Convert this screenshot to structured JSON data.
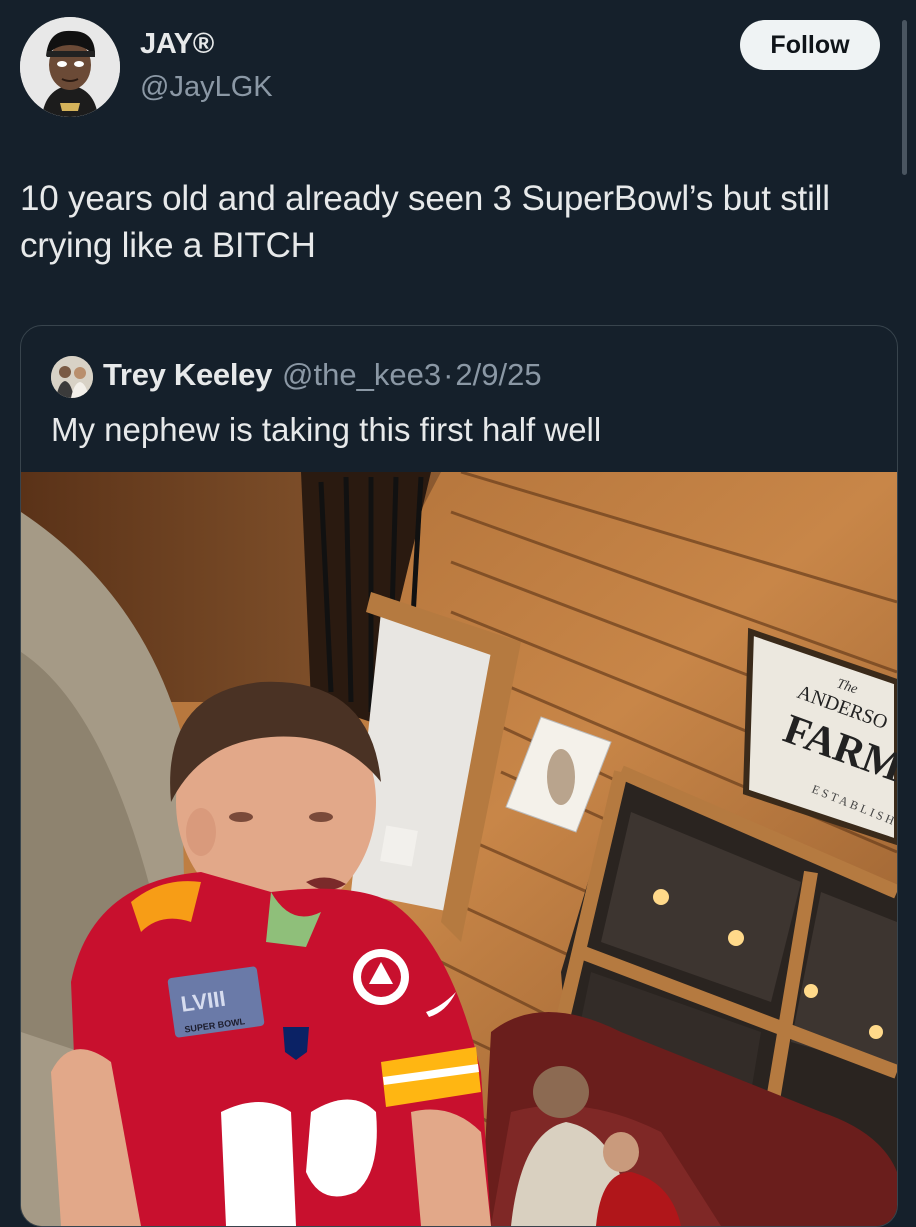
{
  "tweet": {
    "display_name": "JAY®",
    "handle": "@JayLGK",
    "follow_label": "Follow",
    "text": "10 years old and already seen 3 SuperBowl’s but still crying like a BITCH"
  },
  "quoted_tweet": {
    "display_name": "Trey Keeley",
    "handle": "@the_kee3",
    "separator": "·",
    "date": "2/9/25",
    "text": "My nephew is taking this first half well"
  },
  "photo": {
    "sign_line1": "The",
    "sign_line2": "ANDERSO",
    "sign_line3": "FARMH",
    "sign_line4": "ESTABLISH",
    "patch_line1": "LVIII",
    "patch_line2": "SUPER BOWL"
  },
  "colors": {
    "background": "#15202b",
    "text_primary": "#e7e9ea",
    "text_secondary": "#8b98a5",
    "follow_bg": "#eff3f4",
    "border": "#38444d",
    "jersey_red": "#c8102e",
    "jersey_gold": "#ffb612"
  }
}
